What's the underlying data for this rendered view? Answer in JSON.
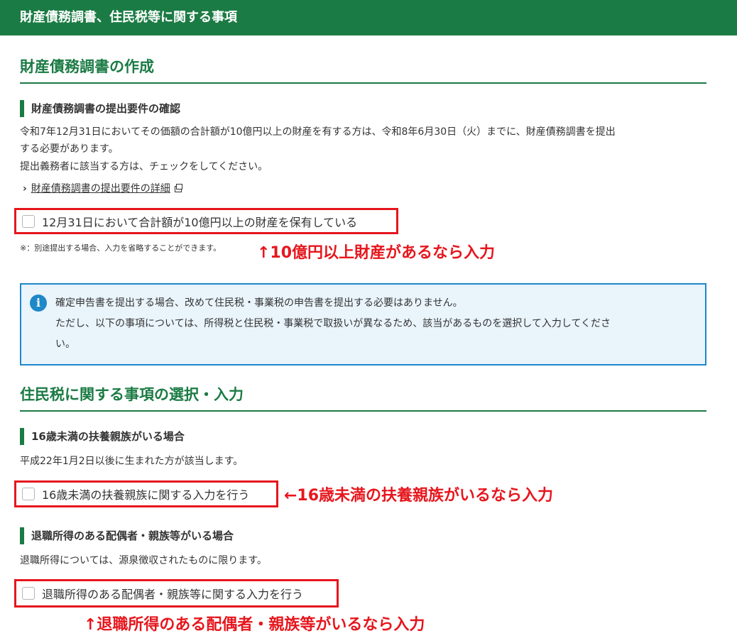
{
  "header": {
    "title": "財産債務調書、住民税等に関する事項"
  },
  "section1": {
    "title": "財産債務調書の作成",
    "subtitle": "財産債務調書の提出要件の確認",
    "desc_line1": "令和7年12月31日においてその価額の合計額が10億円以上の財産を有する方は、令和8年6月30日（火）までに、財産債務調書を提出",
    "desc_line2": "する必要があります。",
    "desc_line3": "提出義務者に該当する方は、チェックをしてください。",
    "link_label": "財産債務調書の提出要件の詳細",
    "checkbox_label": "12月31日において合計額が10億円以上の財産を保有している",
    "note": "※：別途提出する場合、入力を省略することができます。",
    "annotation": "↑10億円以上財産があるなら入力"
  },
  "info": {
    "line1": "確定申告書を提出する場合、改めて住民税・事業税の申告書を提出する必要はありません。",
    "line2": "ただし、以下の事項については、所得税と住民税・事業税で取扱いが異なるため、該当があるものを選択して入力してくださ",
    "line3": "い。"
  },
  "section2": {
    "title": "住民税に関する事項の選択・入力",
    "dependents": {
      "subtitle": "16歳未満の扶養親族がいる場合",
      "desc": "平成22年1月2日以後に生まれた方が該当します。",
      "checkbox_label": "16歳未満の扶養親族に関する入力を行う",
      "annotation": "←16歳未満の扶養親族がいるなら入力"
    },
    "retirement": {
      "subtitle": "退職所得のある配偶者・親族等がいる場合",
      "desc": "退職所得については、源泉徴収されたものに限ります。",
      "checkbox_label": "退職所得のある配偶者・親族等に関する入力を行う",
      "annotation": "↑退職所得のある配偶者・親族等がいるなら入力"
    }
  },
  "colors": {
    "brand_green": "#1b7b44",
    "annotation_red": "#e6161d",
    "info_blue": "#1e88c8"
  },
  "icons": {
    "info": "info-icon",
    "chevron": "chevron-right-icon",
    "external": "external-link-icon"
  }
}
